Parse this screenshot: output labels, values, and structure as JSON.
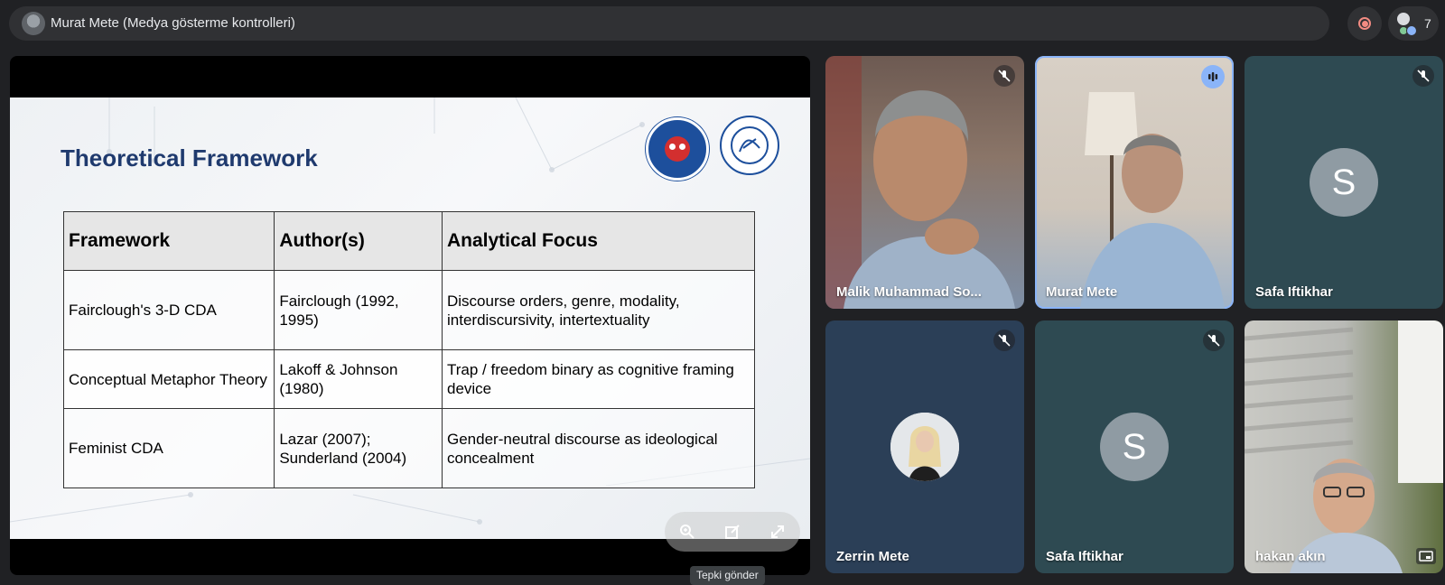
{
  "top_bar": {
    "presenter_title": "Murat Mete (Medya gösterme kontrolleri)",
    "participant_count": "7"
  },
  "slide": {
    "title": "Theoretical Framework",
    "table": {
      "headers": [
        "Framework",
        "Author(s)",
        "Analytical Focus"
      ],
      "rows": [
        [
          "Fairclough's 3-D CDA",
          "Fairclough (1992, 1995)",
          "Discourse orders, genre, modality, interdiscursivity, intertextuality"
        ],
        [
          "Conceptual Metaphor Theory",
          "Lakoff & Johnson (1980)",
          "Trap / freedom binary as cognitive framing device"
        ],
        [
          "Feminist CDA",
          "Lazar (2007); Sunderland (2004)",
          "Gender-neutral discourse as ideological concealment"
        ]
      ]
    }
  },
  "tooltip": "Tepki gönder",
  "tiles": [
    {
      "name": "Malik Muhammad So...",
      "muted": true,
      "speaking": false,
      "avatar_letter": ""
    },
    {
      "name": "Murat Mete",
      "muted": false,
      "speaking": true,
      "avatar_letter": ""
    },
    {
      "name": "Safa Iftikhar",
      "muted": true,
      "speaking": false,
      "avatar_letter": "S"
    },
    {
      "name": "Zerrin Mete",
      "muted": true,
      "speaking": false,
      "avatar_letter": ""
    },
    {
      "name": "Safa Iftikhar",
      "muted": true,
      "speaking": false,
      "avatar_letter": "S"
    },
    {
      "name": "hakan akın",
      "muted": false,
      "speaking": false,
      "avatar_letter": ""
    }
  ],
  "colors": {
    "background": "#202124",
    "slide_title": "#1f3a6e",
    "speaking_accent": "#8ab4f8",
    "record": "#f28b82"
  },
  "icons": {
    "mute": "mic-off-icon",
    "speaking": "audio-bars-icon",
    "record": "record-icon",
    "people": "people-icon",
    "zoom": "zoom-in-icon",
    "popout": "open-in-new-icon",
    "fullscreen": "fullscreen-icon",
    "pip": "picture-in-picture-icon"
  }
}
